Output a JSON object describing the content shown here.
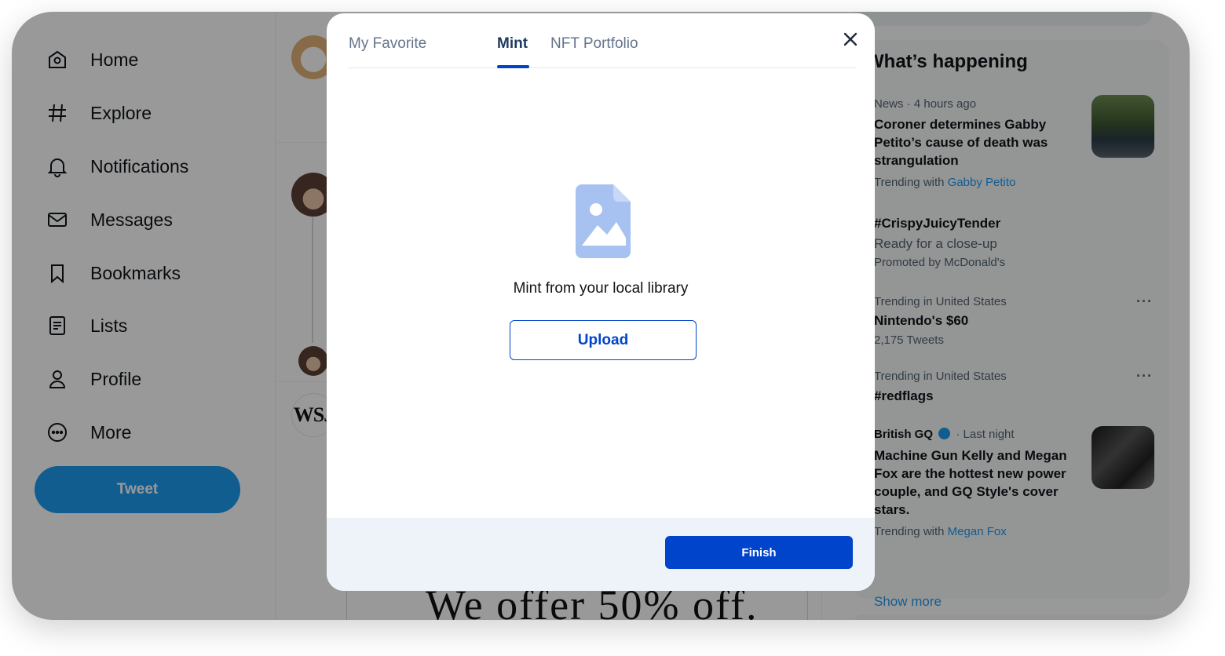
{
  "sidebar": {
    "items": [
      {
        "label": "Home",
        "icon": "home-icon"
      },
      {
        "label": "Explore",
        "icon": "hashtag-icon"
      },
      {
        "label": "Notifications",
        "icon": "bell-icon"
      },
      {
        "label": "Messages",
        "icon": "envelope-icon"
      },
      {
        "label": "Bookmarks",
        "icon": "bookmark-icon"
      },
      {
        "label": "Lists",
        "icon": "list-icon"
      },
      {
        "label": "Profile",
        "icon": "person-icon"
      },
      {
        "label": "More",
        "icon": "more-circle-icon"
      }
    ],
    "tweet_label": "Tweet"
  },
  "timeline": {
    "wsj_label": "WSJ",
    "ad_text": "We offer 50% off."
  },
  "trends": {
    "heading": "What’s happening",
    "items": [
      {
        "meta": "News · 4 hours ago",
        "title_lines": [
          "Coroner determines Gabby",
          "Petito’s cause of death was",
          "strangulation"
        ],
        "sub_prefix": "Trending with",
        "sub_link": "Gabby Petito"
      },
      {
        "title": "#CrispyJuicyTender",
        "desc": "Ready for a close-up",
        "promoted": "Promoted by McDonald's"
      },
      {
        "meta": "Trending in United States",
        "title": "Nintendo's $60",
        "count": "2,175 Tweets"
      },
      {
        "meta": "Trending in United States",
        "title": "#redflags"
      },
      {
        "source": "British GQ",
        "time": "· Last night",
        "title_lines": [
          "Machine Gun Kelly and Megan",
          "Fox are the hottest new power",
          "couple, and GQ Style's cover",
          "stars."
        ],
        "sub_prefix": "Trending with",
        "sub_link": "Megan Fox"
      }
    ],
    "more_glyph": "···",
    "show_more": "Show more"
  },
  "modal": {
    "tabs": [
      "My Favorite",
      "Mint",
      "NFT Portfolio"
    ],
    "active_tab": "Mint",
    "close_glyph": "×",
    "mint_text": "Mint from your local library",
    "upload_label": "Upload",
    "finish_label": "Finish"
  },
  "colors": {
    "accent": "#0044cc",
    "twitter_blue": "#1d9bf0",
    "image_icon": "#a7c1f1",
    "footer_bg": "#eef3fa"
  }
}
